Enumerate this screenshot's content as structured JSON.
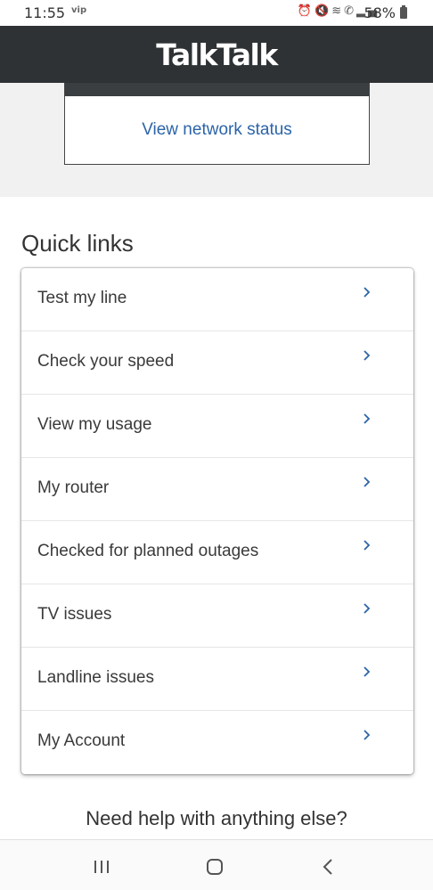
{
  "status_bar": {
    "time": "11:55",
    "carrier_tag": "vip",
    "icons": [
      "alarm-icon",
      "mute-icon",
      "wifi-icon",
      "wifi-calling-icon",
      "signal-icon"
    ],
    "battery": "58%"
  },
  "header": {
    "logo": "TalkTalk",
    "background_color": "#2e3235"
  },
  "network": {
    "link_label": "View network status",
    "link_color": "#2b64a8"
  },
  "quick_links": {
    "title": "Quick links",
    "items": [
      {
        "label": "Test my line"
      },
      {
        "label": "Check your speed"
      },
      {
        "label": "View my usage"
      },
      {
        "label": "My router"
      },
      {
        "label": "Checked for planned outages"
      },
      {
        "label": "TV issues"
      },
      {
        "label": "Landline issues"
      },
      {
        "label": "My Account"
      }
    ]
  },
  "help": {
    "text": "Need help with anything else?"
  },
  "nav_bar": {
    "buttons": [
      "recents-icon",
      "home-icon",
      "back-icon"
    ]
  }
}
